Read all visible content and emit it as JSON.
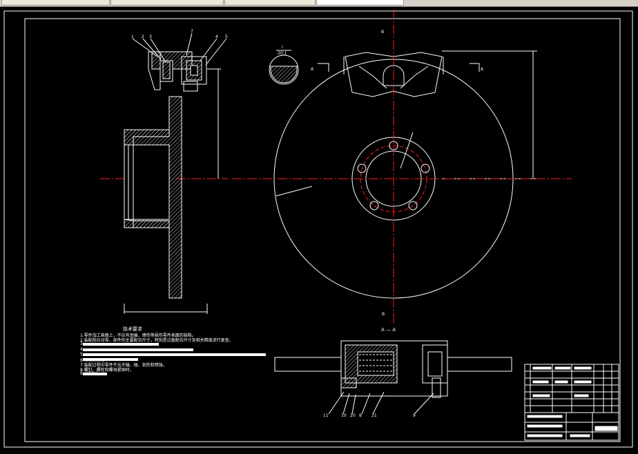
{
  "tabs": [
    "",
    "",
    "",
    ""
  ],
  "colors": {
    "background": "#000000",
    "line": "#ffffff",
    "centerline": "#ff2020",
    "hatch": "#cfcfcf"
  },
  "section_marks": {
    "b_top": "B",
    "b_bottom": "B",
    "a_left": "A",
    "a_right": "A"
  },
  "detail": {
    "id": "I",
    "scale": "20:1"
  },
  "part_numbers_top": [
    "1",
    "2",
    "3",
    "7",
    "4",
    "5"
  ],
  "part_numbers_bottom": [
    "11",
    "10",
    "20",
    "8",
    "21",
    "9"
  ],
  "section_title": "A — A",
  "tech_requirements": {
    "title": "技术要求",
    "lines": [
      "1.零件加工表面上，不应有划痕、擦伤等损伤零件表面的缺陷。",
      "2.装配前应对零、部件的主要配合尺寸，特别是过盈配合尺寸及相关精度进行复查。",
      "3.",
      "4.",
      "5.",
      "6.                                    0.10mm。",
      "7.装配过程中零件不允许磕、碰、划伤和锈蚀。",
      "8.螺钉、螺栓和螺母紧固时。",
      "9.                    H7/h6"
    ]
  },
  "title_block": {
    "label": "title-block"
  }
}
